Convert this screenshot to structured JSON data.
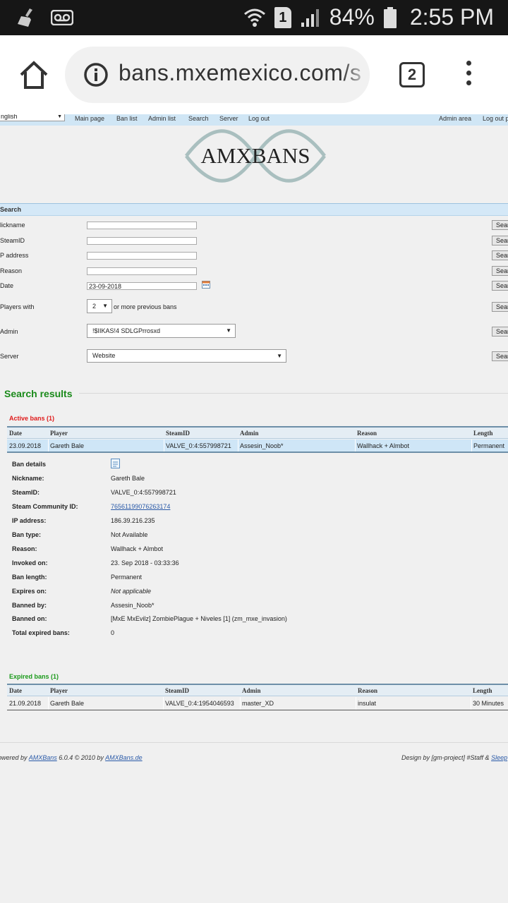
{
  "status_bar": {
    "battery": "84%",
    "time": "2:55 PM",
    "sim_slot": "1",
    "icons": [
      "broom-icon",
      "voicemail-icon",
      "wifi-icon",
      "sim-icon",
      "signal-icon",
      "battery-icon"
    ]
  },
  "browser": {
    "url": "bans.mxemexico.com/s",
    "tab_count": "2"
  },
  "nav": {
    "language": "nglish",
    "links": [
      "Main page",
      "Ban list",
      "Admin list",
      "Search",
      "Server",
      "Log out"
    ],
    "admin_area": "Admin area",
    "logout_right": "Log out p"
  },
  "logo": {
    "text": "AMXBANS"
  },
  "search": {
    "title": "Search",
    "button_label": "Search",
    "labels": {
      "nickname": "lickname",
      "steamid": "SteamID",
      "ip": "P address",
      "reason": "Reason",
      "date": "Date",
      "players_with": "Players with",
      "admin": "Admin",
      "server": "Server"
    },
    "date_value": "23-09-2018",
    "previous_bans_value": "2",
    "previous_bans_suffix": "or more previous bans",
    "admin_value": "!$IIKAS!4 SDLGPrrosxd",
    "server_value": "Website"
  },
  "results": {
    "title": "Search results",
    "columns": [
      "Date",
      "Player",
      "SteamID",
      "Admin",
      "Reason",
      "Length"
    ],
    "active": {
      "title": "Active bans (1)",
      "color": "#e01a1a",
      "row": [
        "23.09.2018",
        "Gareth Bale",
        "VALVE_0:4:557998721",
        "Assesin_Noob*",
        "Wallhack + Almbot",
        "Permanent"
      ]
    },
    "details": [
      {
        "label": "Ban details",
        "value": ""
      },
      {
        "label": "Nickname:",
        "value": "Gareth Bale"
      },
      {
        "label": "SteamID:",
        "value": "VALVE_0:4:557998721"
      },
      {
        "label": "Steam Community ID:",
        "value": "76561199076263174"
      },
      {
        "label": "IP address:",
        "value": "186.39.216.235"
      },
      {
        "label": "Ban type:",
        "value": "Not Available"
      },
      {
        "label": "Reason:",
        "value": "Wallhack + Almbot"
      },
      {
        "label": "Invoked on:",
        "value": "23. Sep 2018 - 03:33:36"
      },
      {
        "label": "Ban length:",
        "value": "Permanent"
      },
      {
        "label": "Expires on:",
        "value": "Not applicable"
      },
      {
        "label": "Banned by:",
        "value": "Assesin_Noob*"
      },
      {
        "label": "Banned on:",
        "value": "[MxE MxEvilz] ZombiePlague + Niveles [1] (zm_mxe_invasion)"
      },
      {
        "label": "Total expired bans:",
        "value": "0"
      }
    ],
    "expired": {
      "title": "Expired bans (1)",
      "color": "#1a9a1a",
      "row": [
        "21.09.2018",
        "Gareth Bale",
        "VALVE_0:4:1954046593",
        "master_XD",
        "insulat",
        "30 Minutes"
      ]
    }
  },
  "footer": {
    "left_prefix": "owered by",
    "left_link": "AMXBans",
    "left_mid": "6.0.4 © 2010 by",
    "left_link2": "AMXBans.de",
    "right_prefix": "Design by [gm-project] #Staff &",
    "right_link": "Sleep"
  }
}
